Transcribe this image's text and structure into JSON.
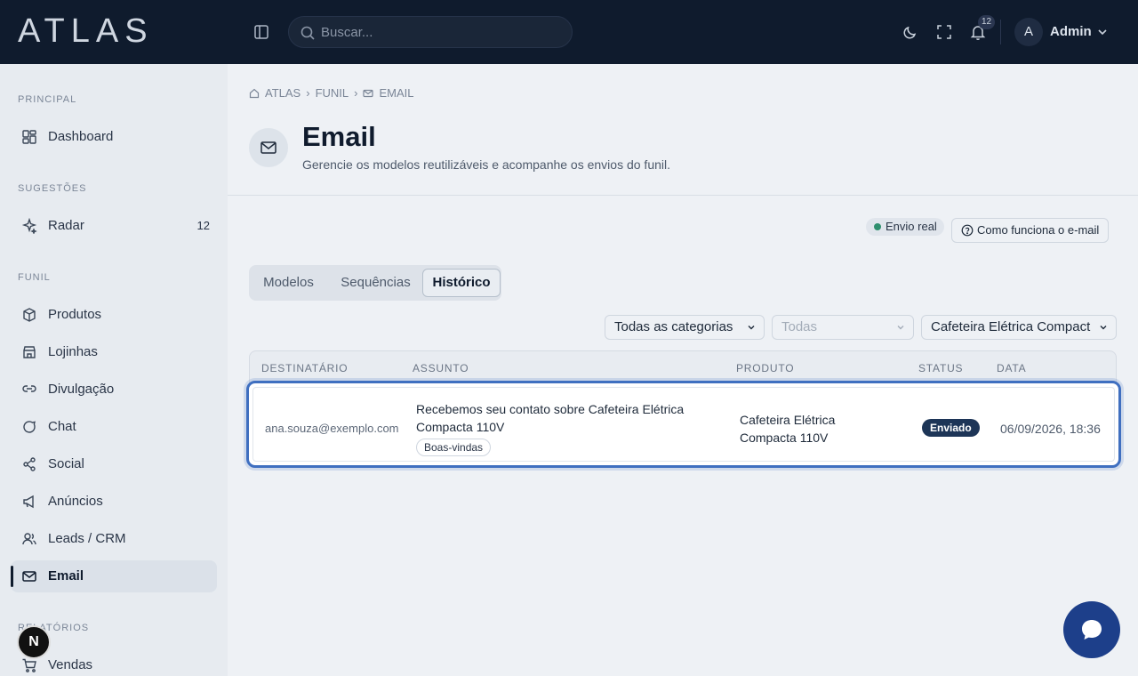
{
  "app": {
    "logo": "ATLAS"
  },
  "topbar": {
    "search_placeholder": "Buscar...",
    "notification_count": "12",
    "avatar_initial": "A",
    "user_name": "Admin"
  },
  "sidebar": {
    "sections": {
      "principal": "PRINCIPAL",
      "sugestoes": "SUGESTÕES",
      "funil": "FUNIL",
      "relatorios": "RELATÓRIOS"
    },
    "items": [
      {
        "label": "Dashboard",
        "icon": "dashboard-icon"
      },
      {
        "label": "Radar",
        "icon": "sparkles-icon",
        "count": "12"
      },
      {
        "label": "Produtos",
        "icon": "box-icon"
      },
      {
        "label": "Lojinhas",
        "icon": "store-icon"
      },
      {
        "label": "Divulgação",
        "icon": "link-icon"
      },
      {
        "label": "Chat",
        "icon": "chat-icon"
      },
      {
        "label": "Social",
        "icon": "share-icon"
      },
      {
        "label": "Anúncios",
        "icon": "megaphone-icon"
      },
      {
        "label": "Leads / CRM",
        "icon": "users-icon"
      },
      {
        "label": "Email",
        "icon": "mail-icon",
        "active": true
      },
      {
        "label": "Vendas",
        "icon": "cart-icon"
      }
    ],
    "dev_badge": "N"
  },
  "breadcrumb": [
    "ATLAS",
    "FUNIL",
    "EMAIL"
  ],
  "page": {
    "title": "Email",
    "subtitle": "Gerencie os modelos reutilizáveis e acompanhe os envios do funil."
  },
  "actions": {
    "real_badge": "Envio real",
    "howto_label": "Como funciona o e-mail"
  },
  "tabs": [
    {
      "label": "Modelos"
    },
    {
      "label": "Sequências"
    },
    {
      "label": "Histórico",
      "active": true
    }
  ],
  "filters": {
    "category": "Todas as categorias",
    "status": "Todas",
    "product": "Cafeteira Elétrica Compact"
  },
  "table": {
    "headers": [
      "DESTINATÁRIO",
      "ASSUNTO",
      "PRODUTO",
      "STATUS",
      "DATA"
    ],
    "rows": [
      {
        "recipient": "ana.souza@exemplo.com",
        "subject": "Recebemos seu contato sobre Cafeteira Elétrica Compacta 110V",
        "tag": "Boas-vindas",
        "product": "Cafeteira Elétrica Compacta 110V",
        "status": "Enviado",
        "date": "06/09/2026, 18:36"
      }
    ]
  },
  "colors": {
    "topbar": "#0f1b2d",
    "accent": "#1d3557",
    "focus_ring": "#3f6fc0",
    "status_ok": "#2f8f6e"
  }
}
